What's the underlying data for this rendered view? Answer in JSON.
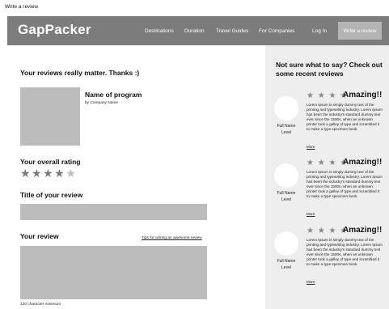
{
  "frame_title": "Write a review",
  "header": {
    "logo": "GapPacker",
    "nav": [
      "Destinations",
      "Duration",
      "Travel Guides",
      "For Companies",
      "Log In"
    ],
    "cta": "Write a review"
  },
  "main": {
    "heading": "Your reviews really matter. Thanks :)",
    "program": {
      "name": "Name of program",
      "company": "by Company Name"
    },
    "rating": {
      "label": "Your overall rating",
      "stars": "★★★★",
      "empty_star": "★",
      "value": 4,
      "max": 5
    },
    "title_section": {
      "label": "Title of your review",
      "value": ""
    },
    "review_section": {
      "label": "Your review",
      "tips": "Tips for writing an awesome review",
      "value": "",
      "min_note": "120 character minimum"
    }
  },
  "sidebar": {
    "heading": "Not sure what to say? Check out some recent reviews",
    "reviews": [
      {
        "stars": "★ ★ ★ ★",
        "title": "Amazing!!",
        "text": "Lorem Ipsum is simply dummy text of the printing and typesetting industry. Lorem Ipsum has been the industry's standard dummy text ever since the 1500s, when an unknown printer took a galley of type and scrambled it to make a type specimen book.",
        "more": "More",
        "name": "Full Name",
        "level": "Level"
      },
      {
        "stars": "★ ★ ★ ★",
        "title": "Amazing!!",
        "text": "Lorem Ipsum is simply dummy text of the printing and typesetting industry. Lorem Ipsum has been the industry's standard dummy text ever since the 1500s, when an unknown printer took a galley of type and scrambled it to make a type specimen book.",
        "more": "More",
        "name": "Full Name",
        "level": "Level"
      },
      {
        "stars": "★ ★ ★ ★",
        "title": "Amazing!!",
        "text": "Lorem Ipsum is simply dummy text of the printing and typesetting industry. Lorem Ipsum has been the industry's standard dummy text ever since the 1500s, when an unknown printer took a galley of type and scrambled it to make a type specimen book.",
        "more": "More",
        "name": "Full Name",
        "level": "Level"
      }
    ]
  },
  "colors": {
    "navbar": "#7c7c7c",
    "cta_button": "#b4b4b4",
    "sidebar": "#eeeeee",
    "placeholder_box": "#bcbcbc"
  }
}
